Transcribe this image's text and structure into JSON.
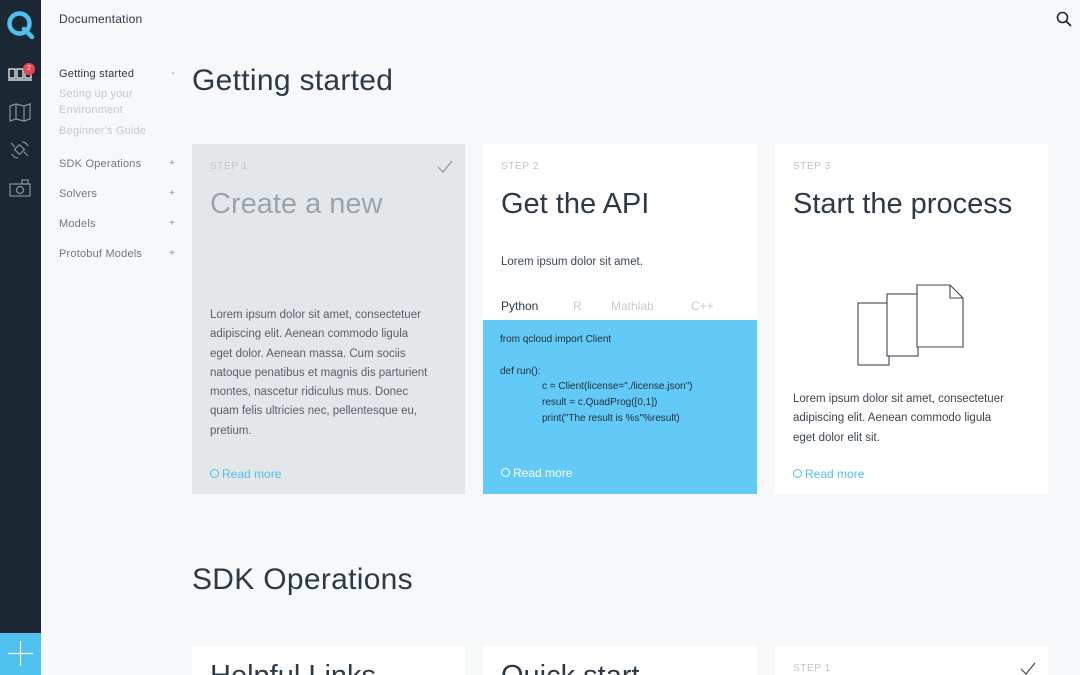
{
  "header": {
    "title": "Documentation"
  },
  "rail": {
    "notifications_count": "2"
  },
  "sidebar": {
    "items": [
      {
        "label": "Getting started",
        "sign": "-",
        "subitems": [
          "Seting up your Environment",
          "Beginner's Guide"
        ]
      },
      {
        "label": "SDK Operations",
        "sign": "+"
      },
      {
        "label": "Solvers",
        "sign": "+"
      },
      {
        "label": "Models",
        "sign": "+"
      },
      {
        "label": "Protobuf Models",
        "sign": "+"
      }
    ]
  },
  "sections": [
    {
      "title": "Getting started",
      "cards": [
        {
          "step": "STEP 1",
          "title": "Create a new",
          "text": [
            "Lorem ipsum dolor sit amet, consectetuer",
            "adipiscing elit. Aenean commodo ligula",
            "eget dolor. Aenean massa. Cum sociis",
            "natoque penatibus et magnis dis parturient",
            "montes, nascetur ridiculus mus. Donec",
            "quam felis ultricies nec, pellentesque eu,",
            "pretium."
          ],
          "read_more": "Read more"
        },
        {
          "step": "STEP 2",
          "title": "Get the API",
          "text": [
            "Lorem ipsum dolor sit amet."
          ],
          "tabs": [
            "Python",
            "R",
            "Mathlab",
            "C++"
          ],
          "code": [
            "from qcloud import Client",
            "",
            "def run():",
            "c = Client(license=\"./license.json\")",
            "result = c.QuadProg([0,1])",
            "print(\"The result is %s\"%result)"
          ],
          "read_more": "Read more"
        },
        {
          "step": "STEP 3",
          "title": "Start the process",
          "text": [
            "Lorem ipsum dolor sit amet, consectetuer",
            "adipiscing elit. Aenean commodo ligula",
            "eget dolor elit sit."
          ],
          "read_more": "Read more"
        }
      ]
    },
    {
      "title": "SDK Operations",
      "cards": [
        {
          "title": "Helpful Links"
        },
        {
          "title": "Quick start"
        },
        {
          "step": "STEP 1"
        }
      ]
    }
  ],
  "colors": {
    "accent": "#4fc1ef",
    "rail": "#1b2733",
    "badge": "#e8474f",
    "code_bg": "#63caf7"
  }
}
